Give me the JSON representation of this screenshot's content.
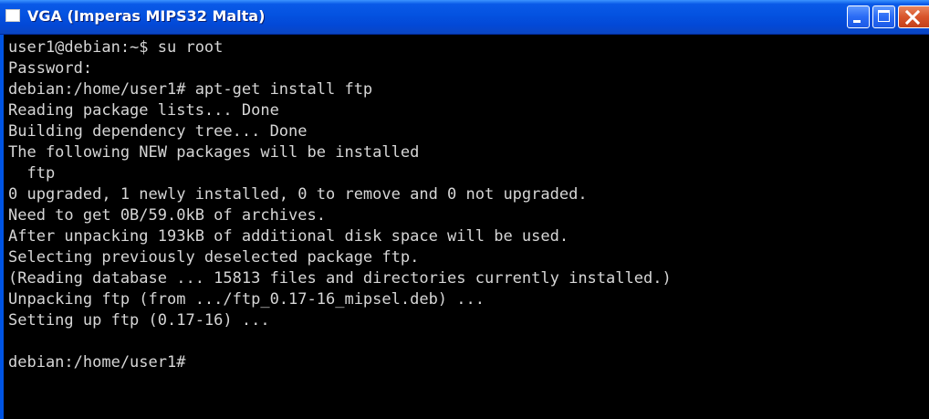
{
  "window": {
    "title": "VGA (Imperas MIPS32 Malta)",
    "icon": "window-app-icon",
    "controls": {
      "minimize_icon": "minimize-icon",
      "maximize_icon": "maximize-icon",
      "close_icon": "close-icon"
    },
    "colors": {
      "titlebar": "#0452e0",
      "close_button": "#d8542a",
      "terminal_bg": "#000000",
      "terminal_fg": "#d6d6d6"
    }
  },
  "terminal": {
    "lines": [
      "user1@debian:~$ su root",
      "Password:",
      "debian:/home/user1# apt-get install ftp",
      "Reading package lists... Done",
      "Building dependency tree... Done",
      "The following NEW packages will be installed",
      "  ftp",
      "0 upgraded, 1 newly installed, 0 to remove and 0 not upgraded.",
      "Need to get 0B/59.0kB of archives.",
      "After unpacking 193kB of additional disk space will be used.",
      "Selecting previously deselected package ftp.",
      "(Reading database ... 15813 files and directories currently installed.)",
      "Unpacking ftp (from .../ftp_0.17-16_mipsel.deb) ...",
      "Setting up ftp (0.17-16) ...",
      "",
      "debian:/home/user1#"
    ]
  }
}
